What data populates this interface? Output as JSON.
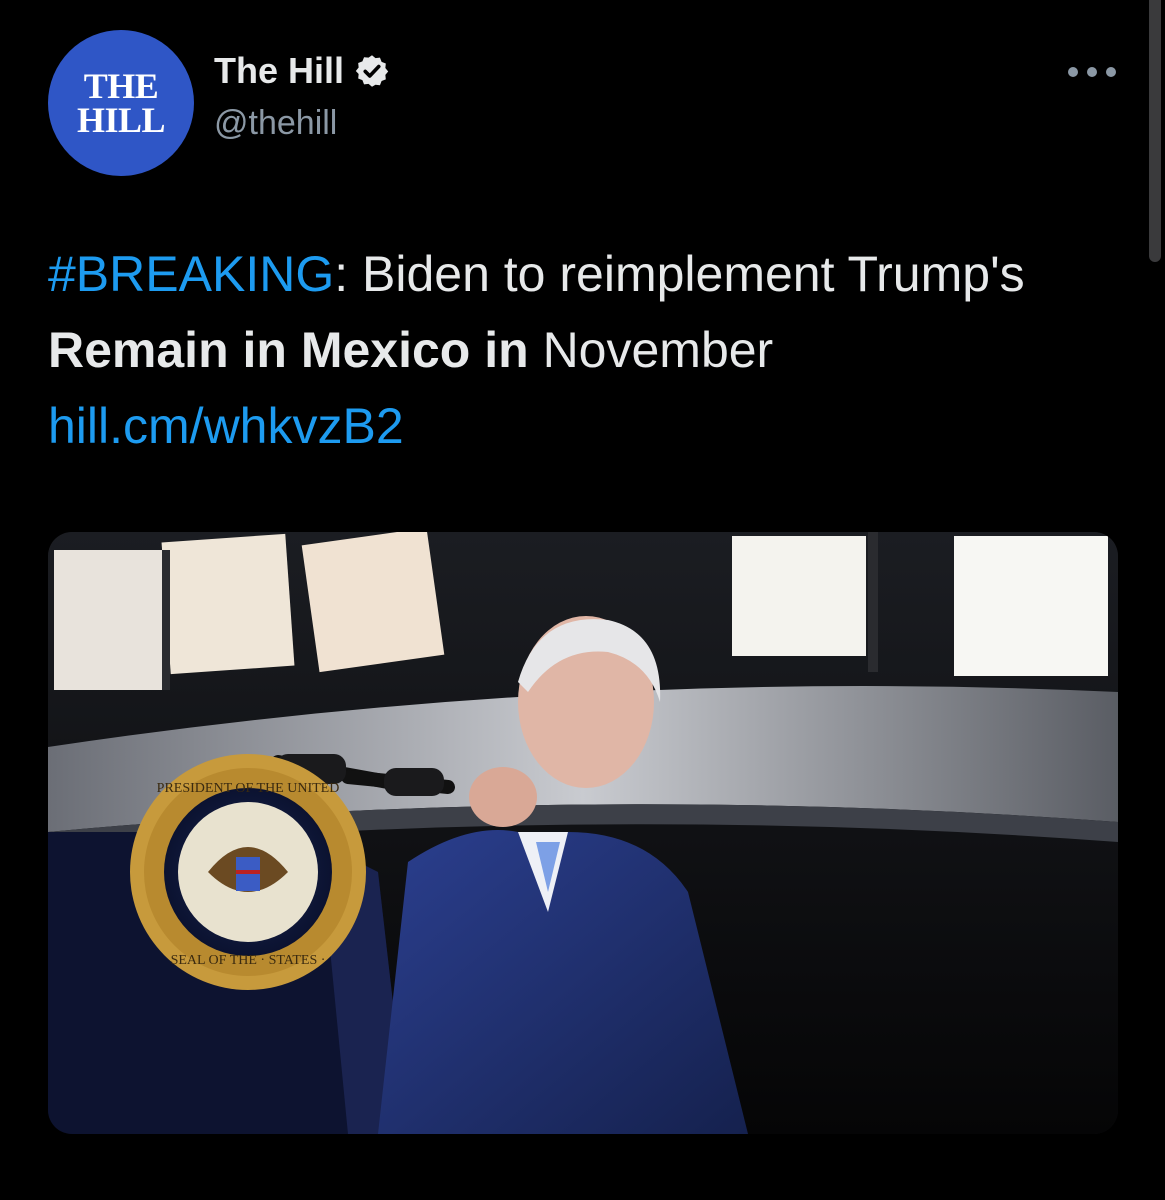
{
  "author": {
    "logo_line1": "THE",
    "logo_line2": "HILL",
    "name": "The Hill",
    "handle": "@thehill",
    "verified_icon": "verified-badge-icon"
  },
  "tweet": {
    "hashtag": "#BREAKING",
    "sep": ":",
    "text1": " Biden to reimplement Trump's ",
    "bold": "Remain in Mexico in",
    "text2": " November ",
    "link": "hill.cm/whkvzB2"
  },
  "media": {
    "seal_ring_top": "PRESIDENT OF THE UNITED",
    "seal_ring_bottom": "SEAL OF THE · STATES ·"
  },
  "icons": {
    "more": "more-options-icon"
  },
  "colors": {
    "background": "#000000",
    "link": "#1d9bf0",
    "avatar": "#2f56c6",
    "secondary": "#8b98a5"
  }
}
